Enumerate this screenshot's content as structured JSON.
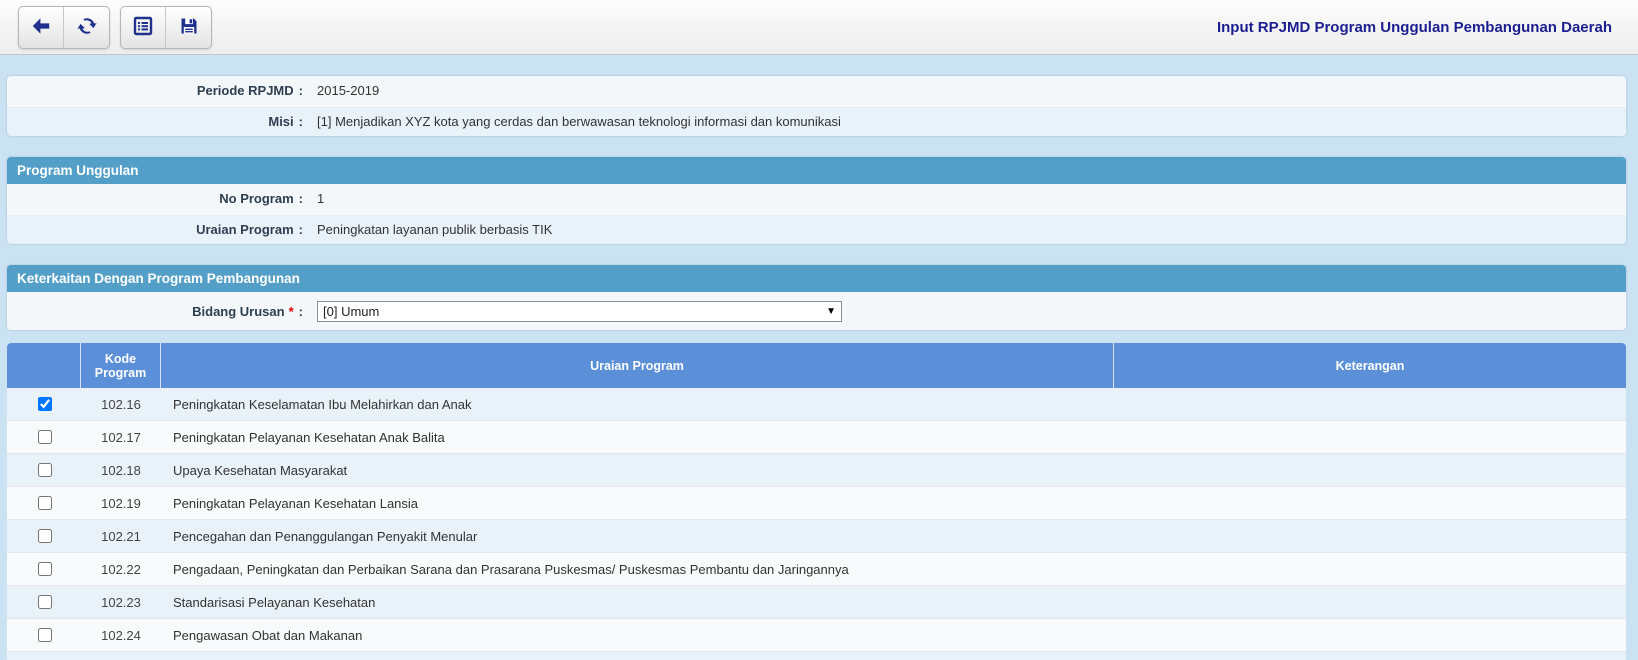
{
  "toolbar": {
    "title": "Input RPJMD Program Unggulan Pembangunan Daerah"
  },
  "misc": {
    "colon": ":",
    "required_mark": "*",
    "dropdown_arrow": "▼"
  },
  "info_panel": {
    "fields": [
      {
        "label": "Periode RPJMD",
        "value": "2015-2019"
      },
      {
        "label": "Misi",
        "value": "[1] Menjadikan XYZ kota yang cerdas dan berwawasan teknologi informasi dan komunikasi"
      }
    ]
  },
  "program_unggulan": {
    "title": "Program Unggulan",
    "fields": [
      {
        "label": "No Program",
        "value": "1"
      },
      {
        "label": "Uraian Program",
        "value": "Peningkatan layanan publik berbasis TIK"
      }
    ]
  },
  "keterkaitan": {
    "title": "Keterkaitan Dengan Program Pembangunan",
    "bidang_urusan": {
      "label": "Bidang Urusan",
      "value": "[0] Umum"
    }
  },
  "table": {
    "headers": {
      "kode": "Kode Program",
      "uraian": "Uraian Program",
      "keterangan": "Keterangan"
    },
    "rows": [
      {
        "checked": true,
        "kode": "102.16",
        "uraian": "Peningkatan Keselamatan Ibu Melahirkan dan Anak",
        "keterangan": ""
      },
      {
        "checked": false,
        "kode": "102.17",
        "uraian": "Peningkatan Pelayanan Kesehatan Anak Balita",
        "keterangan": ""
      },
      {
        "checked": false,
        "kode": "102.18",
        "uraian": "Upaya Kesehatan Masyarakat",
        "keterangan": ""
      },
      {
        "checked": false,
        "kode": "102.19",
        "uraian": "Peningkatan Pelayanan Kesehatan Lansia",
        "keterangan": ""
      },
      {
        "checked": false,
        "kode": "102.21",
        "uraian": "Pencegahan dan Penanggulangan Penyakit Menular",
        "keterangan": ""
      },
      {
        "checked": false,
        "kode": "102.22",
        "uraian": "Pengadaan, Peningkatan dan Perbaikan Sarana dan Prasarana Puskesmas/ Puskesmas Pembantu dan Jaringannya",
        "keterangan": ""
      },
      {
        "checked": false,
        "kode": "102.23",
        "uraian": "Standarisasi Pelayanan Kesehatan",
        "keterangan": ""
      },
      {
        "checked": false,
        "kode": "102.24",
        "uraian": "Pengawasan Obat dan Makanan",
        "keterangan": ""
      }
    ]
  },
  "colors": {
    "page_bg": "#cbe2f2",
    "section_header": "#549fc8",
    "table_header": "#5b90d8",
    "title_text": "#1b1e8e",
    "icon": "#20308d",
    "required": "#dd0000"
  }
}
